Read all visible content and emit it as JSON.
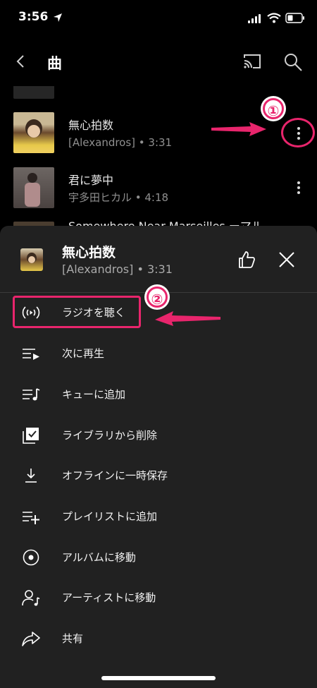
{
  "status_bar": {
    "time": "3:56"
  },
  "header": {
    "title": "曲"
  },
  "songs": [
    {
      "title": "無心拍数",
      "subtitle": "[Alexandros] • 3:31"
    },
    {
      "title": "君に夢中",
      "subtitle": "宇多田ヒカル • 4:18"
    },
    {
      "title": "Somewhere Near Marseilles ーマル"
    }
  ],
  "sheet": {
    "title": "無心拍数",
    "subtitle": "[Alexandros] • 3:31",
    "menu": [
      {
        "label": "ラジオを聴く",
        "icon": "radio-icon"
      },
      {
        "label": "次に再生",
        "icon": "play-next-icon"
      },
      {
        "label": "キューに追加",
        "icon": "add-to-queue-icon"
      },
      {
        "label": "ライブラリから削除",
        "icon": "library-remove-icon"
      },
      {
        "label": "オフラインに一時保存",
        "icon": "download-icon"
      },
      {
        "label": "プレイリストに追加",
        "icon": "playlist-add-icon"
      },
      {
        "label": "アルバムに移動",
        "icon": "album-icon"
      },
      {
        "label": "アーティストに移動",
        "icon": "artist-icon"
      },
      {
        "label": "共有",
        "icon": "share-icon"
      }
    ]
  },
  "annotations": {
    "step1": "①",
    "step2": "②",
    "highlight_color": "#e8256c"
  }
}
